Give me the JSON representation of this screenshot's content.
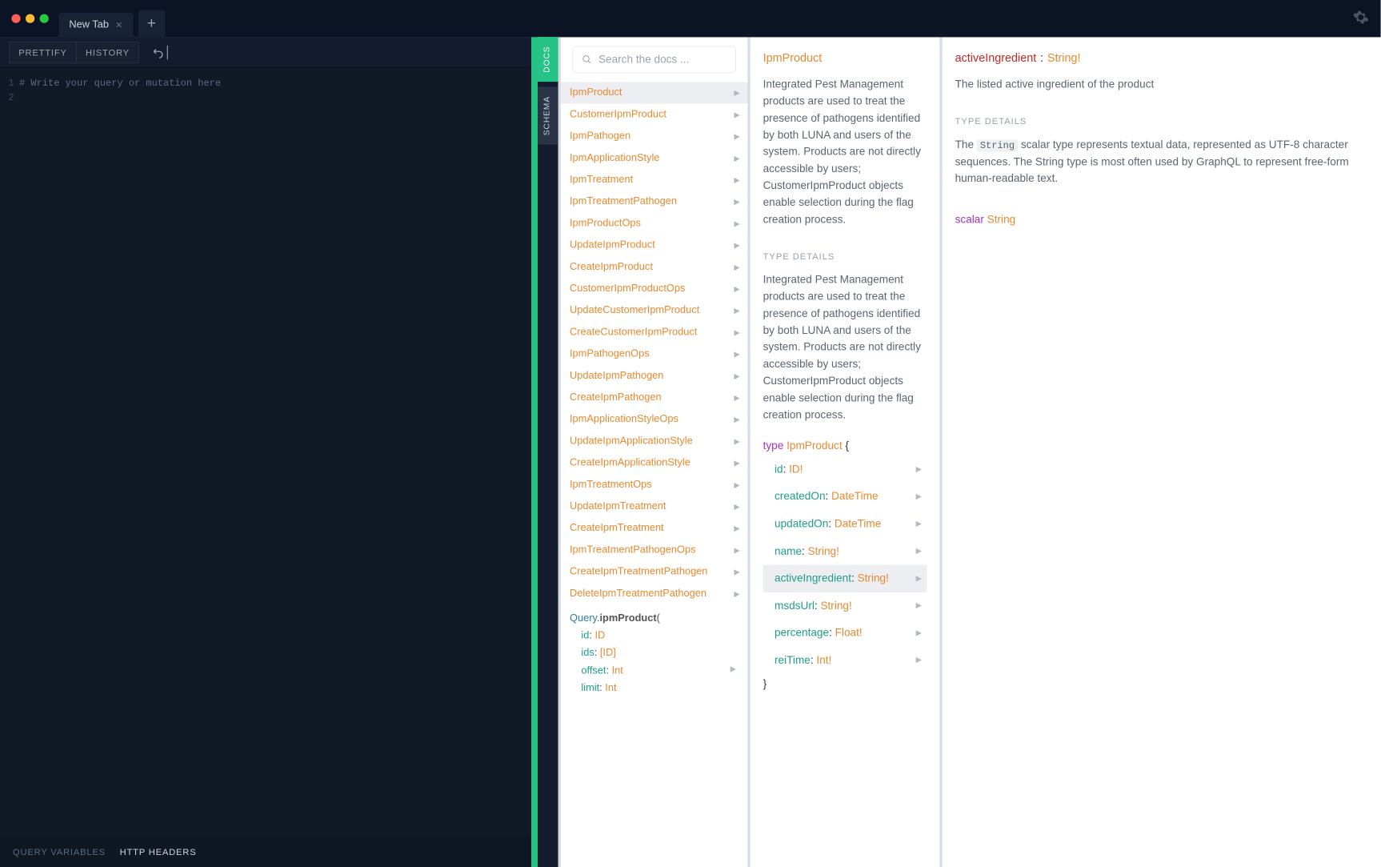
{
  "tabs": {
    "active": "New Tab"
  },
  "toolbar": {
    "prettify": "PRETTIFY",
    "history": "HISTORY"
  },
  "editor": {
    "lines": [
      "1",
      "2"
    ],
    "placeholder": "# Write your query or mutation here"
  },
  "bottom": {
    "qv": "QUERY VARIABLES",
    "hh": "HTTP HEADERS"
  },
  "side": {
    "docs": "DOCS",
    "schema": "SCHEMA"
  },
  "search": {
    "placeholder": "Search the docs ..."
  },
  "types": [
    "IpmProduct",
    "CustomerIpmProduct",
    "IpmPathogen",
    "IpmApplicationStyle",
    "IpmTreatment",
    "IpmTreatmentPathogen",
    "IpmProductOps",
    "UpdateIpmProduct",
    "CreateIpmProduct",
    "CustomerIpmProductOps",
    "UpdateCustomerIpmProduct",
    "CreateCustomerIpmProduct",
    "IpmPathogenOps",
    "UpdateIpmPathogen",
    "CreateIpmPathogen",
    "IpmApplicationStyleOps",
    "UpdateIpmApplicationStyle",
    "CreateIpmApplicationStyle",
    "IpmTreatmentOps",
    "UpdateIpmTreatment",
    "CreateIpmTreatment",
    "IpmTreatmentPathogenOps",
    "CreateIpmTreatmentPathogen",
    "DeleteIpmTreatmentPathogen"
  ],
  "selectedType": "IpmProduct",
  "query": {
    "root": "Query",
    "field": "ipmProduct",
    "args": [
      {
        "name": "id",
        "type": "ID"
      },
      {
        "name": "ids",
        "type": "[ID]"
      },
      {
        "name": "offset",
        "type": "Int"
      },
      {
        "name": "limit",
        "type": "Int"
      }
    ]
  },
  "col2": {
    "title": "IpmProduct",
    "desc": "Integrated Pest Management products are used to treat the presence of pathogens identified by both LUNA and users of the system. Products are not directly accessible by users; CustomerIpmProduct objects enable selection during the flag creation process.",
    "section": "TYPE DETAILS",
    "desc2": "Integrated Pest Management products are used to treat the presence of pathogens identified by both LUNA and users of the system. Products are not directly accessible by users; CustomerIpmProduct objects enable selection during the flag creation process.",
    "kw_type": "type",
    "name": "IpmProduct",
    "fields": [
      {
        "name": "id",
        "type": "ID!"
      },
      {
        "name": "createdOn",
        "type": "DateTime"
      },
      {
        "name": "updatedOn",
        "type": "DateTime"
      },
      {
        "name": "name",
        "type": "String!"
      },
      {
        "name": "activeIngredient",
        "type": "String!"
      },
      {
        "name": "msdsUrl",
        "type": "String!"
      },
      {
        "name": "percentage",
        "type": "Float!"
      },
      {
        "name": "reiTime",
        "type": "Int!"
      }
    ],
    "selectedField": "activeIngredient"
  },
  "col3": {
    "field": "activeIngredient",
    "type": "String!",
    "desc": "The listed active ingredient of the product",
    "section": "TYPE DETAILS",
    "para_pre": "The ",
    "para_code": "String",
    "para_post": " scalar type represents textual data, represented as UTF-8 character sequences. The String type is most often used by GraphQL to represent free-form human-readable text.",
    "scalar_kw": "scalar",
    "scalar_name": "String"
  }
}
